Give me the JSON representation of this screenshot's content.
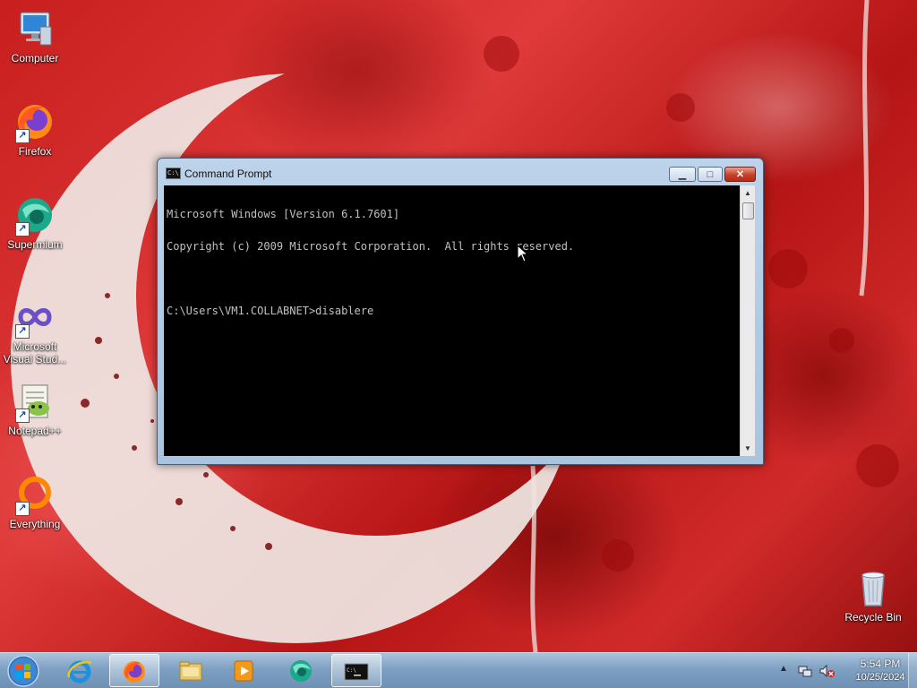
{
  "desktop": {
    "icons": [
      {
        "label": "Computer",
        "icon": "computer-icon"
      },
      {
        "label": "Firefox",
        "icon": "firefox-icon"
      },
      {
        "label": "Supermium",
        "icon": "supermium-icon"
      },
      {
        "label_line1": "Microsoft",
        "label_line2": "Visual Stud...",
        "icon": "visual-studio-icon"
      },
      {
        "label": "Notepad++",
        "icon": "notepadpp-icon"
      },
      {
        "label": "Everything",
        "icon": "everything-icon"
      },
      {
        "label": "Recycle Bin",
        "icon": "recycle-bin-icon"
      }
    ]
  },
  "cmd": {
    "title": "Command Prompt",
    "icon_text": "C:\\",
    "lines": [
      "Microsoft Windows [Version 6.1.7601]",
      "Copyright (c) 2009 Microsoft Corporation.  All rights reserved.",
      "",
      "C:\\Users\\VM1.COLLABNET>disablere"
    ],
    "buttons": {
      "minimize": "▁",
      "maximize": "□",
      "close": "✕"
    }
  },
  "taskbar": {
    "pinned": [
      "internet-explorer",
      "firefox",
      "file-explorer",
      "media-player",
      "supermium",
      "command-prompt"
    ],
    "active": "command-prompt",
    "clock": {
      "time": "5:54 PM",
      "date": "10/25/2024"
    },
    "tray_chevron": "▲"
  },
  "colors": {
    "wallpaper": "#c81e1e",
    "console_bg": "#000000",
    "console_fg": "#c0c0c0",
    "taskbar": "#7ea0c2",
    "close_button": "#c7402a"
  }
}
